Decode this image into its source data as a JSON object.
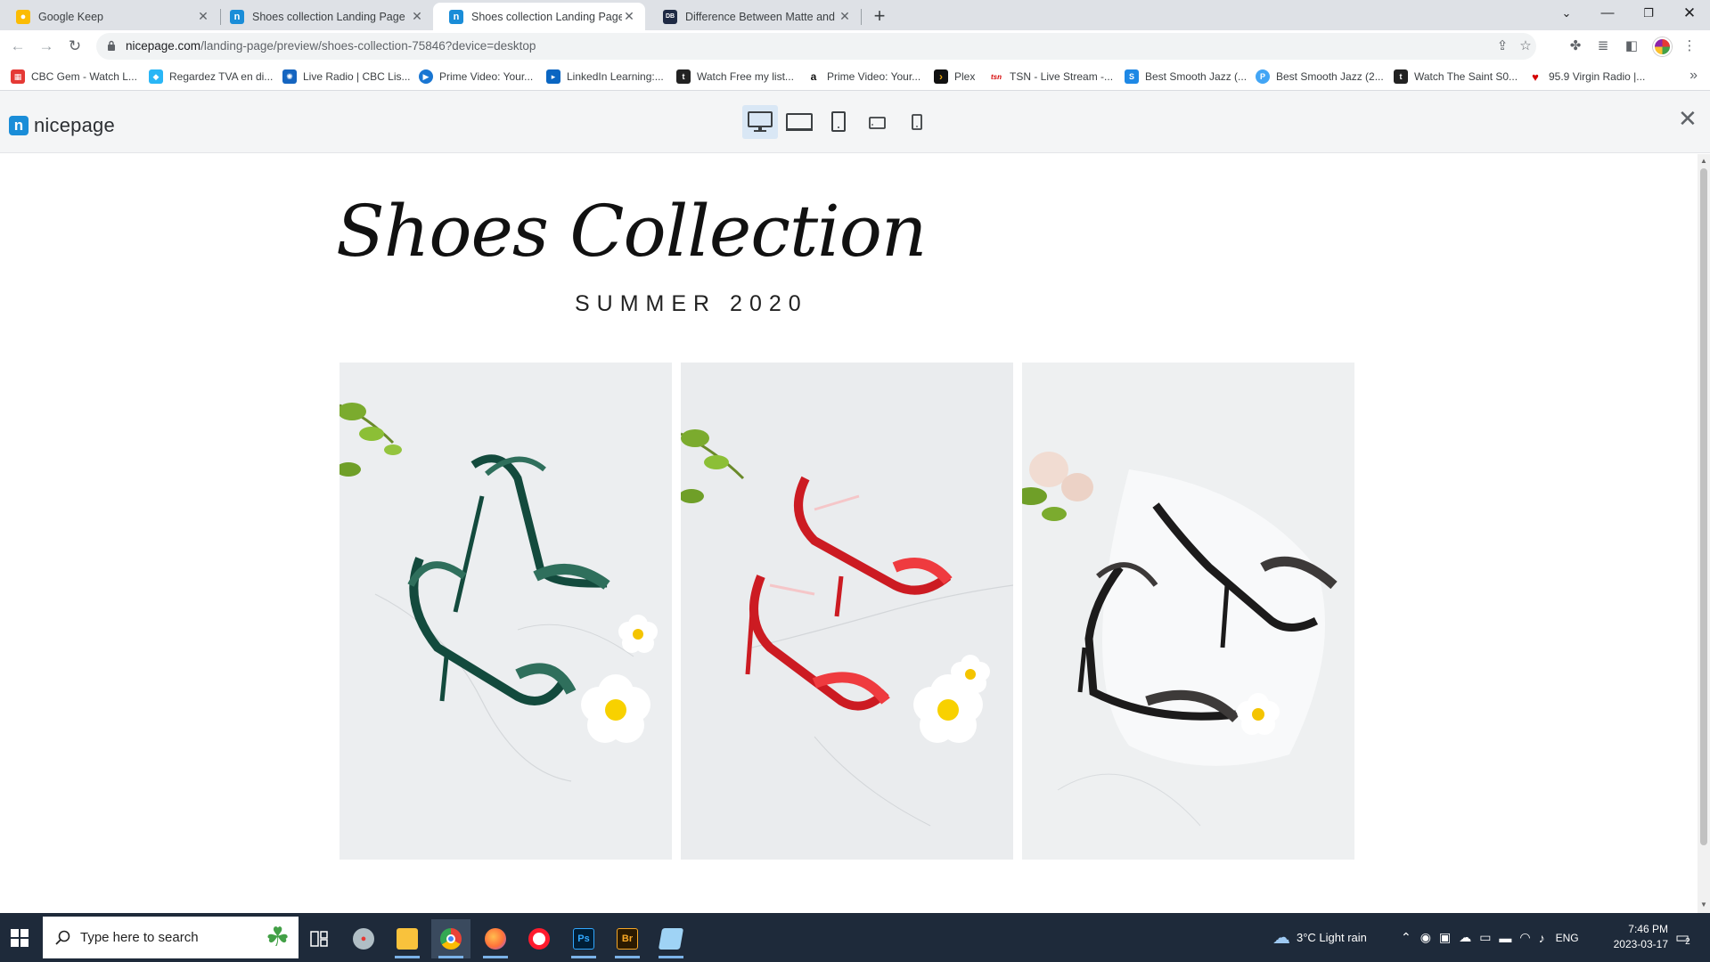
{
  "browser": {
    "tabs": [
      {
        "title": "Google Keep",
        "favicon": "keep-icon",
        "color": "#fbbc04",
        "glyph": "●",
        "active": false
      },
      {
        "title": "Shoes collection Landing Page",
        "favicon": "nicepage-icon",
        "color": "#1a8dd8",
        "glyph": "n",
        "active": false
      },
      {
        "title": "Shoes collection Landing Page L",
        "favicon": "nicepage-icon",
        "color": "#1a8dd8",
        "glyph": "n",
        "active": true
      },
      {
        "title": "Difference Between Matte and Gl",
        "favicon": "dbm-icon",
        "color": "#1f2a44",
        "glyph": "DB",
        "active": false
      }
    ],
    "new_tab_label": "+",
    "url": {
      "host": "nicepage.com",
      "path": "/landing-page/preview/shoes-collection-75846?device=desktop"
    },
    "bookmarks": [
      {
        "label": "CBC Gem - Watch L...",
        "color": "#e53935",
        "glyph": "▦"
      },
      {
        "label": "Regardez TVA en di...",
        "color": "#29b6f6",
        "glyph": "◆"
      },
      {
        "label": "Live Radio | CBC Lis...",
        "color": "#1565c0",
        "glyph": "✺"
      },
      {
        "label": "Prime Video: Your...",
        "color": "#1976d2",
        "glyph": "▶"
      },
      {
        "label": "LinkedIn Learning:...",
        "color": "#0a66c2",
        "glyph": "▸"
      },
      {
        "label": "Watch Free my list...",
        "color": "#222222",
        "glyph": "t"
      },
      {
        "label": "Prime Video: Your...",
        "color": "#ffffff",
        "glyph": "a"
      },
      {
        "label": "Plex",
        "color": "#111111",
        "glyph": "›"
      },
      {
        "label": "TSN - Live Stream -...",
        "color": "#ffffff",
        "glyph": "tsn"
      },
      {
        "label": "Best Smooth Jazz (...",
        "color": "#1e88e5",
        "glyph": "S"
      },
      {
        "label": "Best Smooth Jazz (2...",
        "color": "#42a5f5",
        "glyph": "P"
      },
      {
        "label": "Watch The Saint S0...",
        "color": "#222222",
        "glyph": "t"
      },
      {
        "label": "95.9 Virgin Radio |...",
        "color": "#ffffff",
        "glyph": "♥"
      }
    ],
    "bookmarks_more": "»"
  },
  "nicepage": {
    "logo_text": "nicepage",
    "logo_mark": "n",
    "devices": [
      "desktop-icon",
      "laptop-icon",
      "tablet-icon",
      "tablet-landscape-icon",
      "phone-icon"
    ],
    "active_device": "desktop-icon",
    "close": "✕"
  },
  "page": {
    "title": "Shoes Collection",
    "subtitle": "SUMMER 2020"
  },
  "photos": [
    {
      "name": "green-sandals-photo",
      "shoe_color": "#134a3d",
      "shoe_highlight": "#2f6f5c"
    },
    {
      "name": "red-sandals-photo",
      "shoe_color": "#cc1b22",
      "shoe_highlight": "#ef3b3f"
    },
    {
      "name": "black-sandals-photo",
      "shoe_color": "#1c1b1b",
      "shoe_highlight": "#3d3a39"
    }
  ],
  "taskbar": {
    "search_placeholder": "Type here to search",
    "weather": "3°C  Light rain",
    "language": "ENG",
    "time": "7:46 PM",
    "date": "2023-03-17",
    "notifications": "2"
  }
}
